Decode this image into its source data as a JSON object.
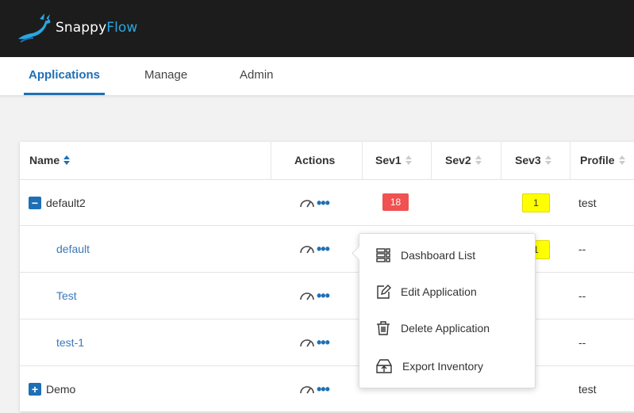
{
  "app": {
    "brand_part1": "Snappy",
    "brand_part2": "Flow"
  },
  "nav": {
    "tabs": [
      {
        "label": "Applications"
      },
      {
        "label": "Manage"
      },
      {
        "label": "Admin"
      }
    ]
  },
  "table": {
    "headers": {
      "name": "Name",
      "actions": "Actions",
      "sev1": "Sev1",
      "sev2": "Sev2",
      "sev3": "Sev3",
      "profile": "Profile"
    },
    "rows": [
      {
        "name": "default2",
        "toggle": "−",
        "sev1": "18",
        "sev3": "1",
        "profile": "test"
      },
      {
        "name": "default",
        "sev3": "1",
        "profile": "--"
      },
      {
        "name": "Test",
        "profile": "--"
      },
      {
        "name": "test-1",
        "profile": "--"
      },
      {
        "name": "Demo",
        "toggle": "+",
        "profile": "test"
      }
    ]
  },
  "actions_menu": {
    "items": [
      {
        "label": "Dashboard List",
        "icon": "dashboard-list-icon"
      },
      {
        "label": "Edit Application",
        "icon": "edit-icon"
      },
      {
        "label": "Delete Application",
        "icon": "trash-icon"
      },
      {
        "label": "Export Inventory",
        "icon": "export-icon"
      }
    ]
  },
  "colors": {
    "accent": "#1f6fb5",
    "sev1_badge": "#f05151",
    "sev3_badge": "#ffff00",
    "topbar": "#1c1c1d"
  }
}
